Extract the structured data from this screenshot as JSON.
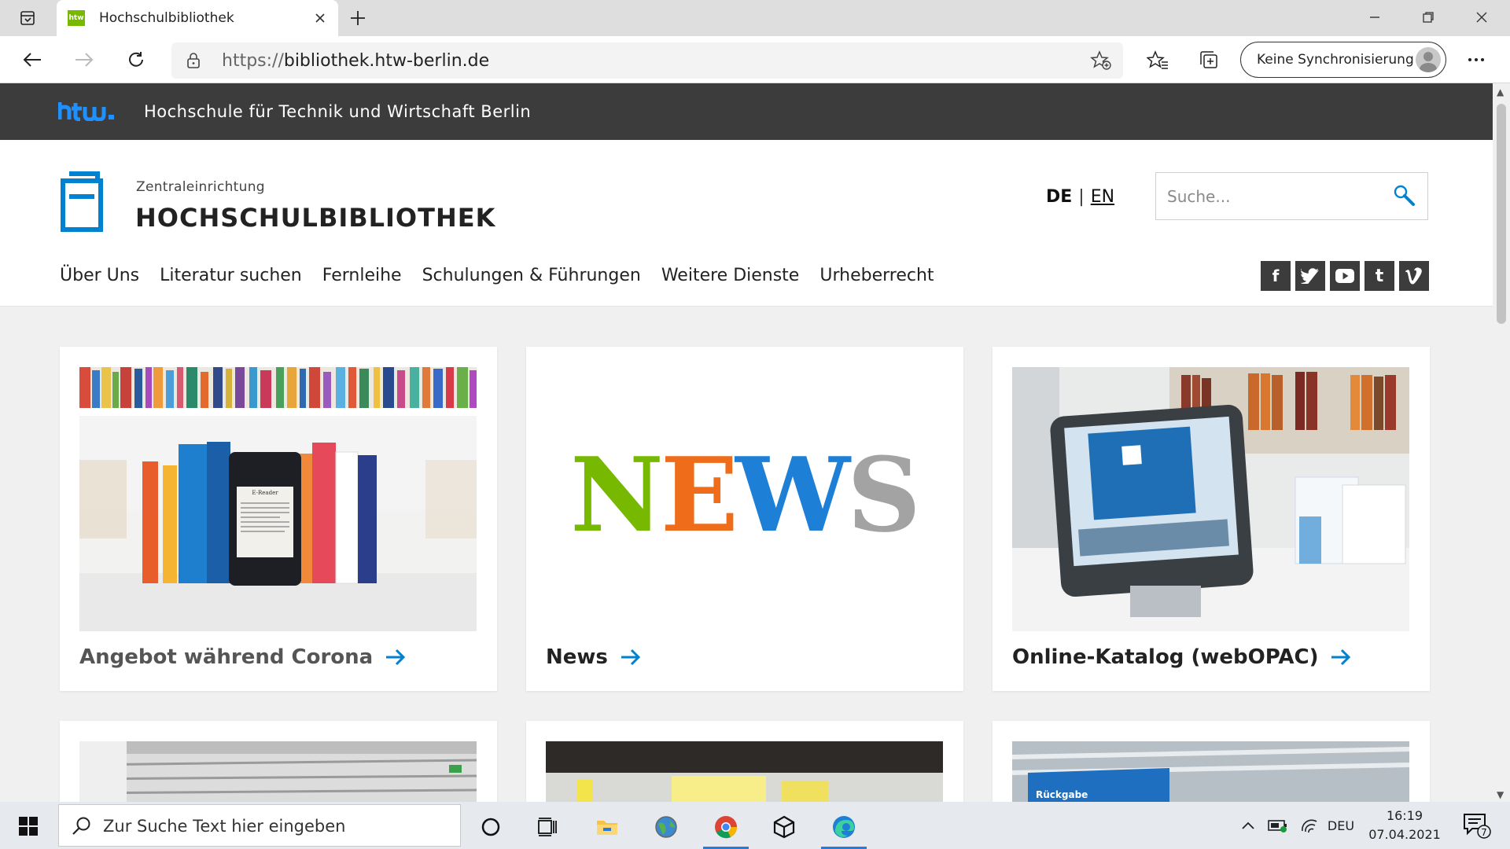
{
  "browser": {
    "tab_title": "Hochschulbibliothek",
    "tab_favicon_text": "htw",
    "url_prefix": "https://",
    "url_host": "bibliothek.htw-berlin.de",
    "sync_label": "Keine Synchronisierung"
  },
  "htw_bar": {
    "logo_text": "htw.",
    "name": "Hochschule für Technik und Wirtschaft Berlin"
  },
  "header": {
    "subtitle": "Zentraleinrichtung",
    "title": "HOCHSCHULBIBLIOTHEK",
    "lang_de": "DE",
    "lang_sep": "|",
    "lang_en": "EN",
    "search_placeholder": "Suche..."
  },
  "nav": {
    "items": [
      "Über Uns",
      "Literatur suchen",
      "Fernleihe",
      "Schulungen & Führungen",
      "Weitere Dienste",
      "Urheberrecht"
    ]
  },
  "social": {
    "facebook": "f",
    "tumblr": "t"
  },
  "cards": [
    {
      "title": "Angebot während Corona"
    },
    {
      "title": "News",
      "image_text": "NEWS"
    },
    {
      "title": "Online-Katalog (webOPAC)"
    }
  ],
  "card_image_labels": {
    "ereader": "E-Reader",
    "rueckgabe": "Rückgabe"
  },
  "taskbar": {
    "search_placeholder": "Zur Suche Text hier eingeben",
    "language": "DEU",
    "time": "16:19",
    "date": "07.04.2021",
    "notification_count": "7"
  },
  "colors": {
    "htw_green": "#76b900",
    "accent_blue": "#0082d1",
    "news_n": "#76b900",
    "news_e": "#ef6c1a",
    "news_w": "#1e7fd6",
    "news_s": "#a3a3a3"
  }
}
